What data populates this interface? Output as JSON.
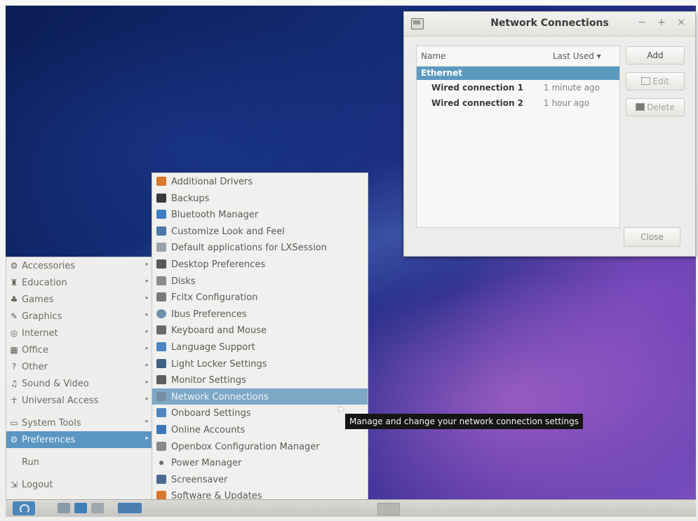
{
  "window": {
    "title": "Network Connections",
    "controls": [
      "−",
      "+",
      "×"
    ],
    "columns": {
      "name": "Name",
      "last_used": "Last Used ▾"
    },
    "group": "Ethernet",
    "connections": [
      {
        "name": "Wired connection 1",
        "last_used": "1 minute ago"
      },
      {
        "name": "Wired connection 2",
        "last_used": "1 hour ago"
      }
    ],
    "buttons": {
      "add": "Add",
      "edit": "Edit",
      "delete": "Delete",
      "close": "Close"
    }
  },
  "main_menu": {
    "items": [
      {
        "label": "Accessories",
        "icon": "accessories-icon"
      },
      {
        "label": "Education",
        "icon": "education-icon"
      },
      {
        "label": "Games",
        "icon": "games-icon"
      },
      {
        "label": "Graphics",
        "icon": "graphics-icon"
      },
      {
        "label": "Internet",
        "icon": "internet-icon"
      },
      {
        "label": "Office",
        "icon": "office-icon"
      },
      {
        "label": "Other",
        "icon": "other-icon"
      },
      {
        "label": "Sound & Video",
        "icon": "sound-video-icon"
      },
      {
        "label": "Universal Access",
        "icon": "universal-access-icon"
      },
      {
        "label": "System Tools",
        "icon": "system-tools-icon"
      },
      {
        "label": "Preferences",
        "icon": "preferences-icon"
      },
      {
        "label": "Run",
        "icon": ""
      },
      {
        "label": "Logout",
        "icon": "logout-icon"
      }
    ],
    "selected": "Preferences"
  },
  "preferences_menu": {
    "items": [
      {
        "label": "Additional Drivers",
        "color": "#d9782d"
      },
      {
        "label": "Backups",
        "color": "#3a3a3a"
      },
      {
        "label": "Bluetooth Manager",
        "color": "#3d7fc1"
      },
      {
        "label": "Customize Look and Feel",
        "color": "#4a78a8"
      },
      {
        "label": "Default applications for LXSession",
        "color": "#9aa2ab"
      },
      {
        "label": "Desktop Preferences",
        "color": "#5a5a5a"
      },
      {
        "label": "Disks",
        "color": "#8c8c8c"
      },
      {
        "label": "Fcitx Configuration",
        "color": "#7a7a7a"
      },
      {
        "label": "Ibus Preferences",
        "color": "#6f8fb0"
      },
      {
        "label": "Keyboard and Mouse",
        "color": "#6a6a6a"
      },
      {
        "label": "Language Support",
        "color": "#4b86c2"
      },
      {
        "label": "Light Locker Settings",
        "color": "#3f5f86"
      },
      {
        "label": "Monitor Settings",
        "color": "#5f5f5f"
      },
      {
        "label": "Network Connections",
        "color": "#7a8ea2"
      },
      {
        "label": "Onboard Settings",
        "color": "#4f86c0"
      },
      {
        "label": "Online Accounts",
        "color": "#3a78b8"
      },
      {
        "label": "Openbox Configuration Manager",
        "color": "#8a8a8a"
      },
      {
        "label": "Power Manager",
        "color": "#6a6a6a"
      },
      {
        "label": "Screensaver",
        "color": "#4a6a92"
      },
      {
        "label": "Software & Updates",
        "color": "#d9782d"
      }
    ],
    "selected": "Network Connections"
  },
  "tooltip": "Manage and change your network connection settings",
  "colors": {
    "selection": "#5b95c2",
    "group_header": "#5b99bf"
  }
}
